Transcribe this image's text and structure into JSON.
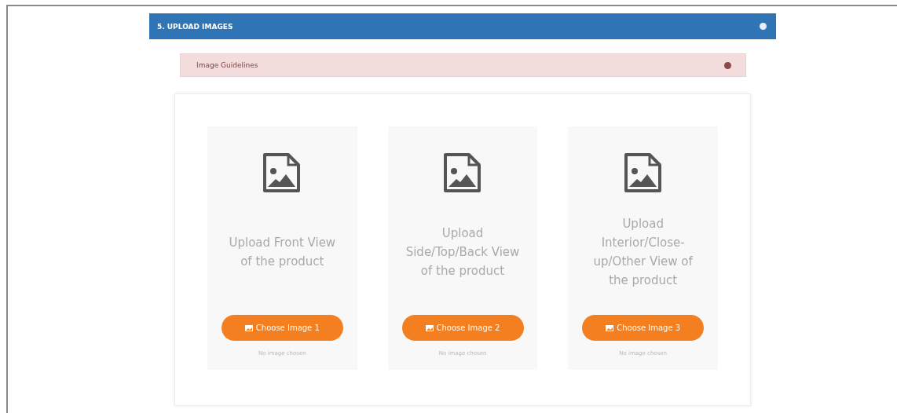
{
  "section": {
    "title": "5. UPLOAD IMAGES",
    "guidelines": {
      "label": "Image Guidelines"
    }
  },
  "slots": [
    {
      "caption": "Upload Front View of the product",
      "button": "Choose Image 1",
      "status": "No image chosen"
    },
    {
      "caption": "Upload Side/Top/Back View of the product",
      "button": "Choose Image 2",
      "status": "No image chosen"
    },
    {
      "caption": "Upload Interior/Close-up/Other View of the product",
      "button": "Choose Image 3",
      "status": "No image chosen"
    }
  ]
}
